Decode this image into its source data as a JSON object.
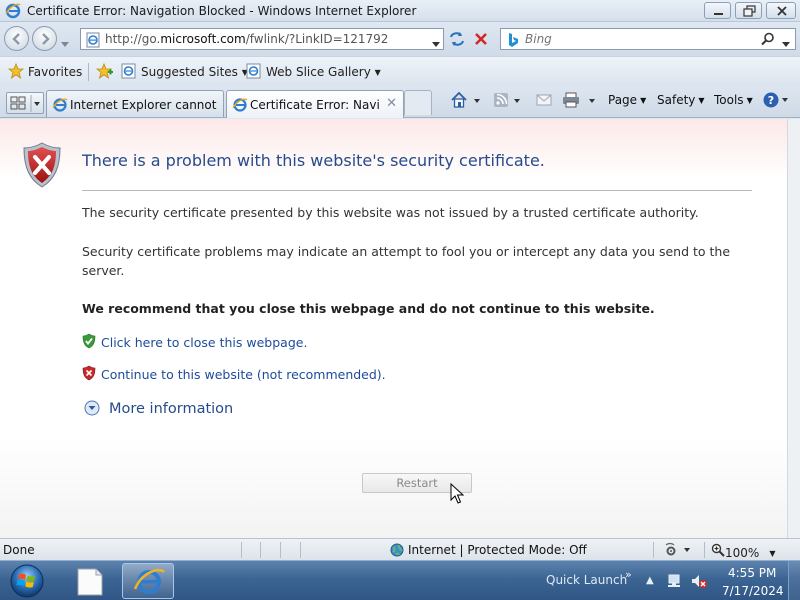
{
  "window": {
    "title": "Certificate Error: Navigation Blocked - Windows Internet Explorer"
  },
  "address": {
    "url_prefix": "http://go.",
    "url_domain": "microsoft.com",
    "url_path": "/fwlink/?LinkID=121792"
  },
  "search": {
    "placeholder": "Bing"
  },
  "favorites_bar": {
    "favorites_label": "Favorites",
    "suggested_sites_label": "Suggested Sites",
    "web_slice_label": "Web Slice Gallery"
  },
  "tabs": [
    {
      "label": "Internet Explorer cannot di..."
    },
    {
      "label": "Certificate Error: Navig..."
    }
  ],
  "command_bar": {
    "page": "Page",
    "safety": "Safety",
    "tools": "Tools"
  },
  "content": {
    "heading": "There is a problem with this website's security certificate.",
    "paragraph1": "The security certificate presented by this website was not issued by a trusted certificate authority.",
    "paragraph2": "Security certificate problems may indicate an attempt to fool you or intercept any data you send to the server.",
    "recommendation": "We recommend that you close this webpage and do not continue to this website.",
    "close_link": "Click here to close this webpage.",
    "continue_link": "Continue to this website (not recommended).",
    "more_info": "More information",
    "restart_button": "Restart"
  },
  "status_bar": {
    "status": "Done",
    "zone": "Internet | Protected Mode: Off",
    "zoom": "100%"
  },
  "taskbar": {
    "quick_launch": "Quick Launch",
    "time": "4:55 PM",
    "date": "7/17/2024"
  },
  "colors": {
    "heading": "#264b8c",
    "link": "#1d4b9c",
    "shield_red": "#c42a2a",
    "shield_green": "#3a9a3a",
    "taskbar": "#3d6594"
  }
}
